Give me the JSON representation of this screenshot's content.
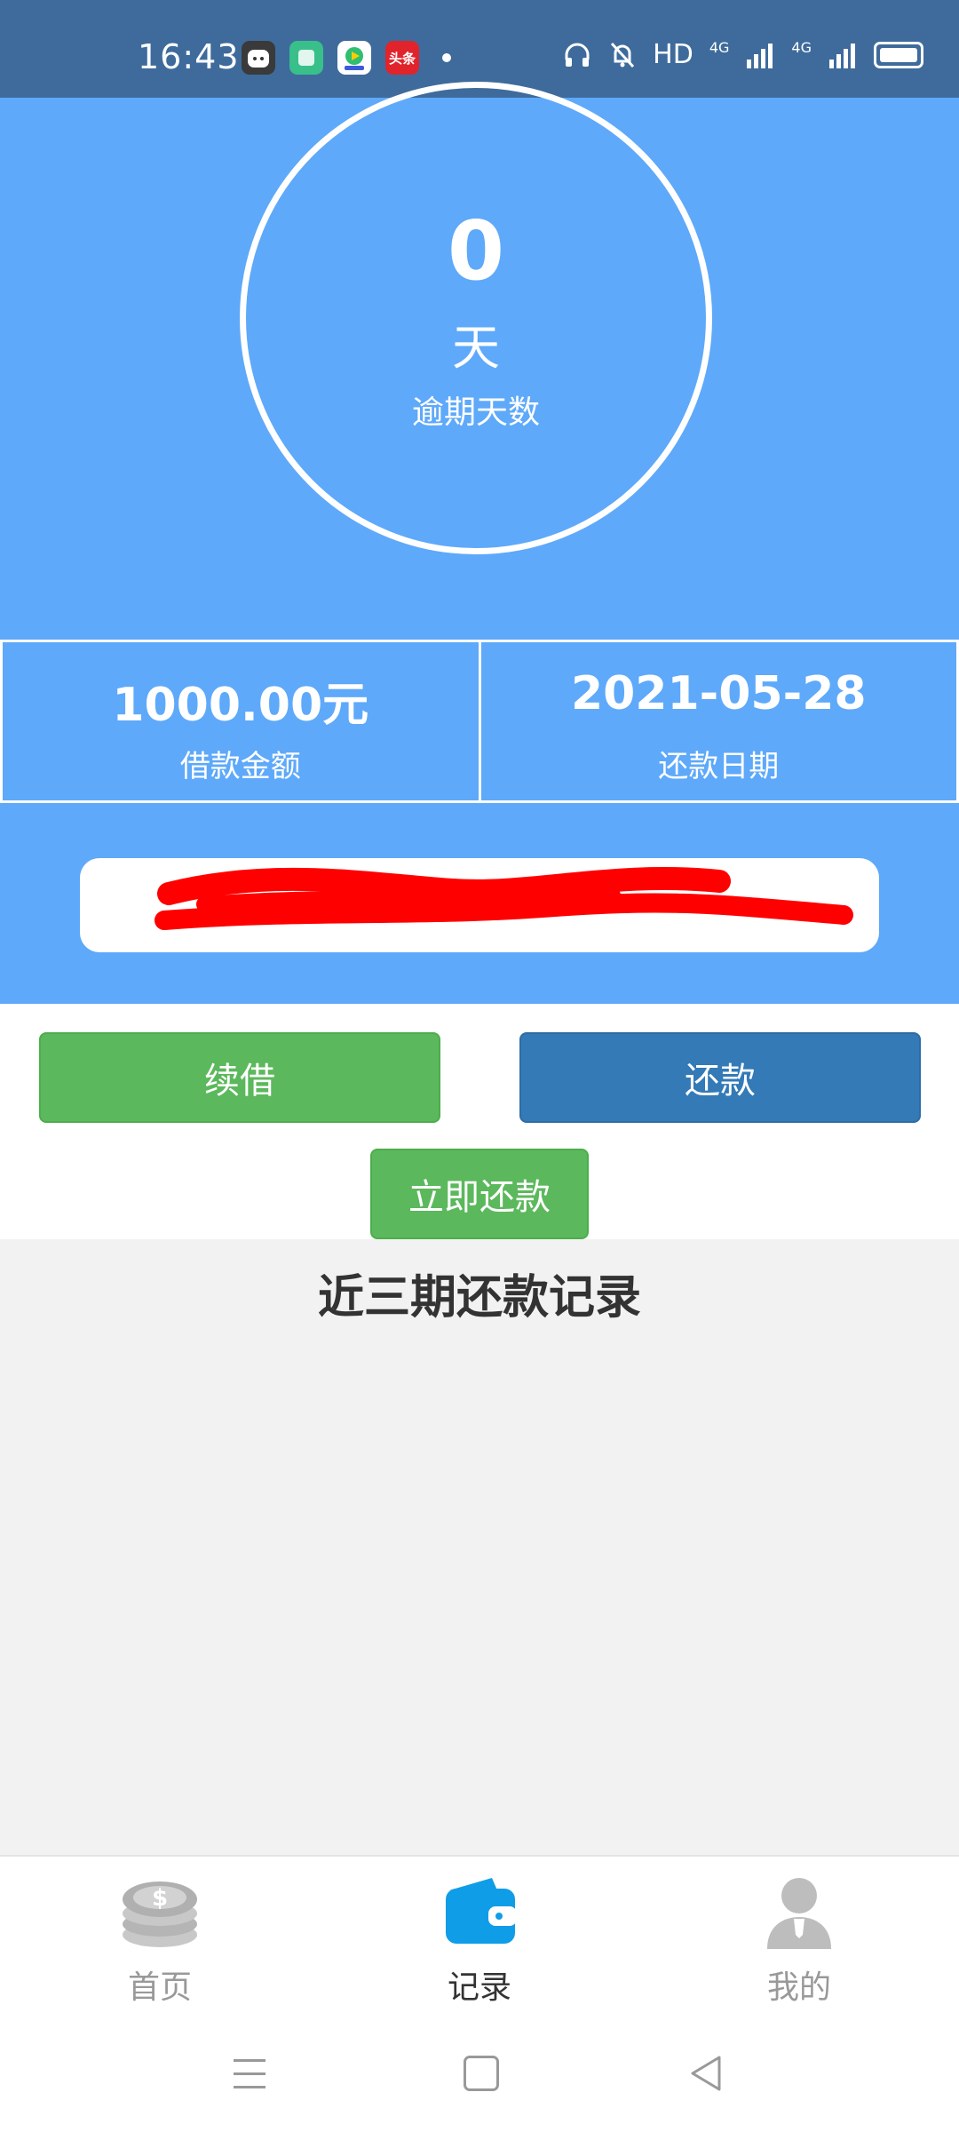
{
  "status_bar": {
    "time": "16:43",
    "apps": [
      {
        "icon": "robot-app-icon",
        "color": "#3a3a3a"
      },
      {
        "icon": "green-app-icon",
        "color": "#39c08a"
      },
      {
        "icon": "video-app-icon",
        "color": "#ffffff"
      },
      {
        "icon": "toutiao-app-icon",
        "label": "头条",
        "color": "#e1232c"
      }
    ],
    "network_hd": "HD",
    "signal_1": "4G",
    "signal_2": "4G"
  },
  "overdue": {
    "days": "0",
    "unit": "天",
    "label": "逾期天数"
  },
  "loan": {
    "amount": "1000.00元",
    "amount_label": "借款金额",
    "due_date": "2021-05-28",
    "due_date_label": "还款日期"
  },
  "notice": {
    "text": "",
    "redacted": true
  },
  "actions": {
    "renew_label": "续借",
    "repay_label": "还款",
    "repay_now_label": "立即还款"
  },
  "records": {
    "title": "近三期还款记录",
    "items": []
  },
  "tabbar": {
    "tabs": [
      {
        "label": "首页",
        "icon": "coins-icon",
        "active": false
      },
      {
        "label": "记录",
        "icon": "wallet-icon",
        "active": true
      },
      {
        "label": "我的",
        "icon": "user-icon",
        "active": false
      }
    ]
  },
  "colors": {
    "status_bar": "#3e6b9c",
    "hero_blue": "#5ea9fa",
    "green_button": "#5cb85c",
    "blue_button": "#337ab7",
    "active_tab_icon": "#0f9de8",
    "inactive_tab": "#999999"
  }
}
